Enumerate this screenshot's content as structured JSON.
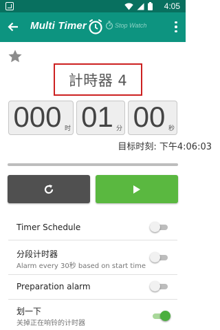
{
  "status_bar": {
    "time": "4:05",
    "left_icon": "screenshot-icon",
    "icons": [
      "wifi-icon",
      "signal-icon",
      "battery-icon"
    ]
  },
  "app_bar": {
    "title": "Multi Timer",
    "stopwatch_label": "Stop Watch",
    "color": "#0d9480"
  },
  "timer": {
    "name": "計時器 4",
    "hours": "000",
    "hours_unit": "时",
    "minutes": "01",
    "minutes_unit": "分",
    "seconds": "00",
    "seconds_unit": "秒",
    "target_time": "目标时刻: 下午4:06:03"
  },
  "controls": {
    "reset_icon": "refresh-icon",
    "start_icon": "play-icon",
    "start_color": "#5ab840",
    "reset_color": "#505050"
  },
  "settings": {
    "timer_schedule": {
      "title": "Timer Schedule",
      "enabled": false
    },
    "interval_timer": {
      "title": "分段计时器",
      "subtitle": "Alarm every 30秒 based on start time",
      "enabled": false
    },
    "preparation_alarm": {
      "title": "Preparation alarm",
      "enabled": false
    },
    "swipe": {
      "title": "划一下",
      "subtitle": "关掉正在响铃的计时器",
      "enabled": true
    }
  }
}
